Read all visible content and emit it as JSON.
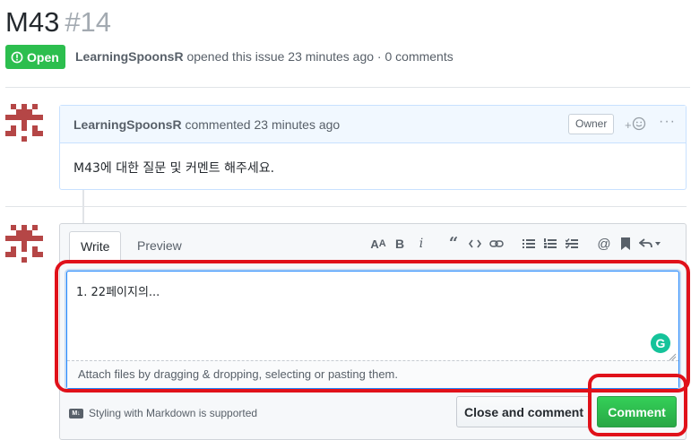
{
  "issue": {
    "title": "M43",
    "number": "#14",
    "state": "Open",
    "author": "LearningSpoonsR",
    "meta_text": " opened this issue 23 minutes ago · 0 comments"
  },
  "comment": {
    "author": "LearningSpoonsR",
    "action_text": " commented 23 minutes ago",
    "role_label": "Owner",
    "body": "M43에 대한 질문 및 커멘트 해주세요."
  },
  "form": {
    "tabs": [
      {
        "label": "Write",
        "active": true
      },
      {
        "label": "Preview",
        "active": false
      }
    ],
    "toolbar_icons": [
      "header-icon",
      "bold-icon",
      "italic-icon",
      "quote-icon",
      "code-icon",
      "link-icon",
      "unordered-list-icon",
      "ordered-list-icon",
      "task-list-icon",
      "mention-icon",
      "saved-reply-icon",
      "reply-icon"
    ],
    "textarea_value": "1. 22페이지의...",
    "attach_hint": "Attach files by dragging & dropping, selecting or pasting them.",
    "markdown_note": "Styling with Markdown is supported",
    "close_button": "Close and comment",
    "comment_button": "Comment"
  },
  "colors": {
    "open_green": "#2cbe4e",
    "comment_green": "#28a745",
    "annotation_red": "#e0111a",
    "comment_header": "#f1f8ff"
  }
}
